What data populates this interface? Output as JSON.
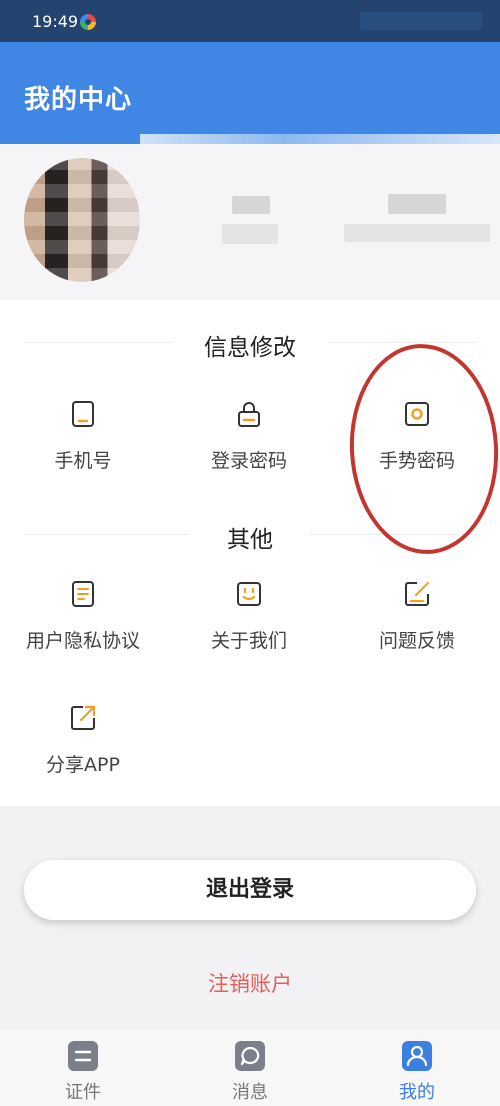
{
  "status_bar": {
    "time": "19:49"
  },
  "header": {
    "title": "我的中心"
  },
  "sections": {
    "info_title": "信息修改",
    "other_title": "其他"
  },
  "info_items": [
    {
      "label": "手机号",
      "icon": "phone-icon"
    },
    {
      "label": "登录密码",
      "icon": "lock-icon"
    },
    {
      "label": "手势密码",
      "icon": "gesture-icon"
    }
  ],
  "other_items": [
    {
      "label": "用户隐私协议",
      "icon": "document-icon"
    },
    {
      "label": "关于我们",
      "icon": "smile-icon"
    },
    {
      "label": "问题反馈",
      "icon": "edit-icon"
    },
    {
      "label": "分享APP",
      "icon": "share-icon"
    }
  ],
  "actions": {
    "logout": "退出登录",
    "cancel_account": "注销账户"
  },
  "tabbar": [
    {
      "label": "证件",
      "icon": "id-card-icon",
      "active": false
    },
    {
      "label": "消息",
      "icon": "message-icon",
      "active": false
    },
    {
      "label": "我的",
      "icon": "profile-icon",
      "active": true
    }
  ],
  "colors": {
    "status_bar": "#24436e",
    "header": "#4087e5",
    "icon_accent": "#f0a020",
    "danger_text": "#e0605a",
    "tab_active": "#3d7fe0",
    "annotation": "#c3362f"
  }
}
